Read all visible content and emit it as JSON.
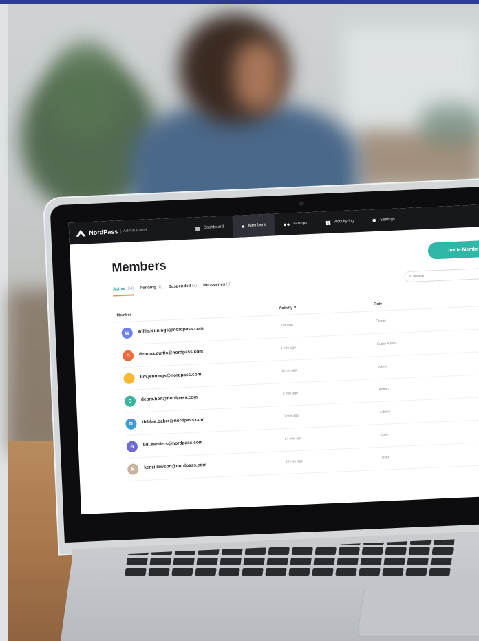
{
  "app": {
    "brand": "NordPass",
    "separator": "|",
    "subtitle": "Admin Panel"
  },
  "nav": {
    "items": [
      {
        "label": "Dashboard",
        "icon": "dashboard-icon",
        "glyph": "▦"
      },
      {
        "label": "Members",
        "icon": "person-icon",
        "glyph": "●"
      },
      {
        "label": "Groups",
        "icon": "people-icon",
        "glyph": "●●"
      },
      {
        "label": "Activity log",
        "icon": "activity-bars-icon",
        "glyph": "▮▮"
      },
      {
        "label": "Settings",
        "icon": "gear-icon",
        "glyph": "✹"
      }
    ],
    "active": "Members"
  },
  "page": {
    "title": "Members",
    "invite_label": "Invite Members"
  },
  "tabs": [
    {
      "label": "Active",
      "count": "(24)"
    },
    {
      "label": "Pending",
      "count": "(6)"
    },
    {
      "label": "Suspended",
      "count": "(3)"
    },
    {
      "label": "Recoveries",
      "count": "(0)"
    }
  ],
  "search": {
    "placeholder": "Search"
  },
  "table": {
    "columns": {
      "member": "Member",
      "activity": "Activity ∨",
      "role": "Role"
    },
    "rows": [
      {
        "email": "willie.jennings@nordpass.com",
        "activity": "Just now",
        "role": "Owner",
        "avatar": "W",
        "color": "#6e7fe6"
      },
      {
        "email": "deanna.curtis@nordpass.com",
        "activity": "1 min ago",
        "role": "Super Admin",
        "avatar": "D",
        "color": "#ef6b3d"
      },
      {
        "email": "tim.jennings@nordpass.com",
        "activity": "3 min ago",
        "role": "Admin",
        "avatar": "T",
        "color": "#f5b82e"
      },
      {
        "email": "debra.holt@nordpass.com",
        "activity": "5 min ago",
        "role": "Admin",
        "avatar": "D",
        "color": "#3bb3a0"
      },
      {
        "email": "debbie.baker@nordpass.com",
        "activity": "6 min ago",
        "role": "Admin",
        "avatar": "D",
        "color": "#3a9fd1"
      },
      {
        "email": "bill.sanders@nordpass.com",
        "activity": "24 min ago",
        "role": "User",
        "avatar": "B",
        "color": "#6d6bd1"
      },
      {
        "email": "kenzi.lawson@nordpass.com",
        "activity": "27 min ago",
        "role": "User",
        "avatar": "K",
        "color": "#c8b39e"
      }
    ]
  },
  "colors": {
    "accent": "#2fb6a6",
    "tab_underline": "#e8944a",
    "navbar": "#17181c"
  }
}
